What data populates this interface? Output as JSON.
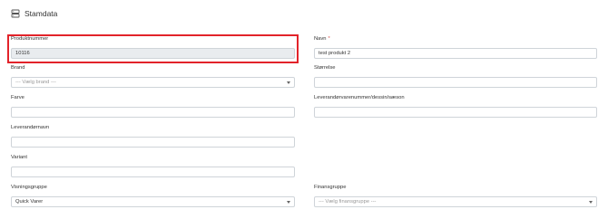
{
  "section": {
    "title": "Stamdata",
    "icon": "database-icon"
  },
  "left": {
    "produktnummer": {
      "label": "Produktnummer",
      "value": "10116"
    },
    "brand": {
      "label": "Brand",
      "placeholder": "--- Vælg brand ---"
    },
    "farve": {
      "label": "Farve",
      "value": ""
    },
    "leverandornavn": {
      "label": "Leverandørnavn",
      "value": ""
    },
    "variant": {
      "label": "Variant",
      "value": ""
    },
    "visningsgruppe": {
      "label": "Visningsgruppe",
      "value": "Quick Varer"
    }
  },
  "right": {
    "navn": {
      "label": "Navn",
      "required_mark": "*",
      "value": "test produkt 2"
    },
    "storrelse": {
      "label": "Størrelse",
      "value": ""
    },
    "leverandorvarenummer": {
      "label": "Leverandørvarenummer/dessin/sæson",
      "value": ""
    },
    "finansgruppe": {
      "label": "Finansgruppe",
      "placeholder": "--- Vælg finansgruppe ---"
    }
  },
  "colors": {
    "highlight": "#e2232a",
    "required": "#d9534f"
  }
}
